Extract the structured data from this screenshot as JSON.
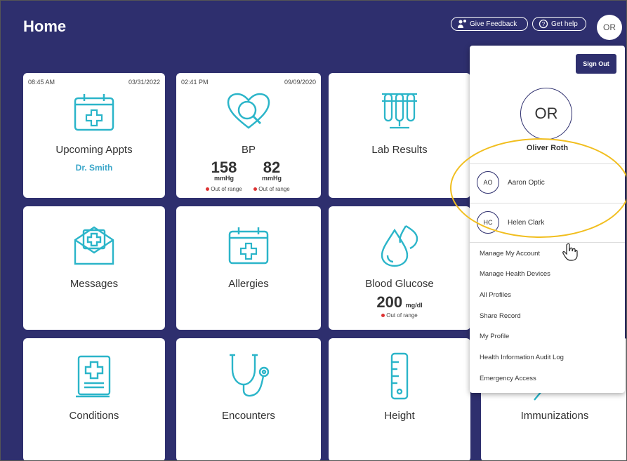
{
  "header": {
    "title": "Home",
    "feedback_label": "Give Feedback",
    "help_label": "Get help",
    "avatar_initials": "OR"
  },
  "tiles": {
    "appts": {
      "time": "08:45 AM",
      "date": "03/31/2022",
      "label": "Upcoming Appts",
      "sub": "Dr. Smith"
    },
    "bp": {
      "time": "02:41 PM",
      "date": "09/09/2020",
      "label": "BP",
      "systolic": "158",
      "diastolic": "82",
      "unit": "mmHg",
      "status": "Out of range"
    },
    "lab": {
      "label": "Lab Results"
    },
    "messages": {
      "label": "Messages"
    },
    "allergies": {
      "label": "Allergies"
    },
    "glucose": {
      "label": "Blood Glucose",
      "value": "200",
      "unit": "mg/dl",
      "status": "Out of range"
    },
    "conditions": {
      "label": "Conditions"
    },
    "encounters": {
      "label": "Encounters"
    },
    "height": {
      "label": "Height"
    },
    "immunizations": {
      "label": "Immunizations"
    }
  },
  "menu": {
    "sign_out": "Sign Out",
    "initials": "OR",
    "name": "Oliver Roth",
    "profiles": [
      {
        "initials": "AO",
        "name": "Aaron Optic"
      },
      {
        "initials": "HC",
        "name": "Helen Clark"
      }
    ],
    "items": [
      "Manage My Account",
      "Manage Health Devices",
      "All Profiles",
      "Share Record",
      "My Profile",
      "Health Information Audit Log",
      "Emergency Access"
    ]
  },
  "colors": {
    "header_bg": "#2e2f6e",
    "accent": "#2bb5c9",
    "highlight": "#f1be1e",
    "alert": "#dd3333"
  }
}
